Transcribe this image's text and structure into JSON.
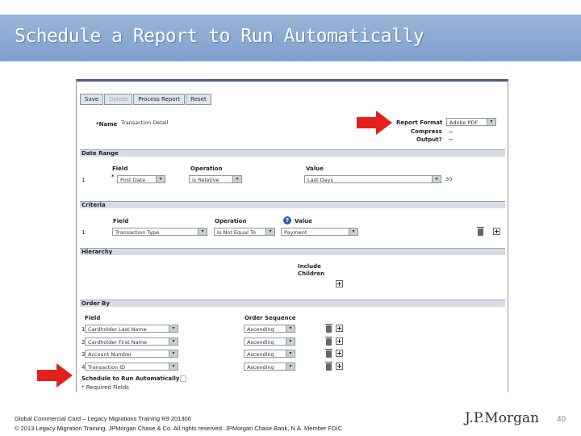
{
  "slide": {
    "title": "Schedule a Report to Run Automatically",
    "page_number": "40",
    "logo": "J.P.Morgan",
    "footer_line1": "Global Commercial Card – Legacy Migrations Training R9 201306",
    "footer_line2": "© 2013 Legacy Migration Training. JPMorgan Chase & Co. All rights reserved. JPMorgan Chase Bank, N.A. Member FDIC"
  },
  "toolbar": {
    "save": "Save",
    "delete": "Delete",
    "process_report": "Process Report",
    "reset": "Reset"
  },
  "header": {
    "name_label": "*Name",
    "name_value": "Transaction Detail",
    "report_format_label": "Report Format",
    "report_format_value": "Adobe PDF",
    "compress_label": "Compress",
    "output_label": "Output?"
  },
  "date_range": {
    "title": "Date Range",
    "field_header": "Field",
    "operation_header": "Operation",
    "value_header": "Value",
    "row_num": "1",
    "field_value": "Post Date",
    "operation_value": "is Relative",
    "value_value": "Last Days",
    "days_value": "30"
  },
  "criteria": {
    "title": "Criteria",
    "field_header": "Field",
    "operation_header": "Operation",
    "value_header": "Value",
    "row_num": "1",
    "field_value": "Transaction Type",
    "operation_value": "Is Not Equal To",
    "value_value": "Payment",
    "help": "?"
  },
  "hierarchy": {
    "title": "Hierarchy",
    "include_children_line1": "Include",
    "include_children_line2": "Children"
  },
  "order_by": {
    "title": "Order By",
    "field_header": "Field",
    "sequence_header": "Order Sequence",
    "rows": [
      {
        "num": "1",
        "field": "Cardholder Last Name",
        "seq": "Ascending"
      },
      {
        "num": "2",
        "field": "Cardholder First Name",
        "seq": "Ascending"
      },
      {
        "num": "3",
        "field": "Account Number",
        "seq": "Ascending"
      },
      {
        "num": "4",
        "field": "Transaction ID",
        "seq": "Ascending"
      }
    ]
  },
  "schedule": {
    "label": "Schedule to Run Automatically",
    "required_note": "* Required Fields"
  },
  "icons": {
    "dropdown": "▾",
    "plus": "+"
  },
  "colors": {
    "banner": "#8aa8d3",
    "arrow": "#e3211c",
    "section": "#d7dce6"
  }
}
